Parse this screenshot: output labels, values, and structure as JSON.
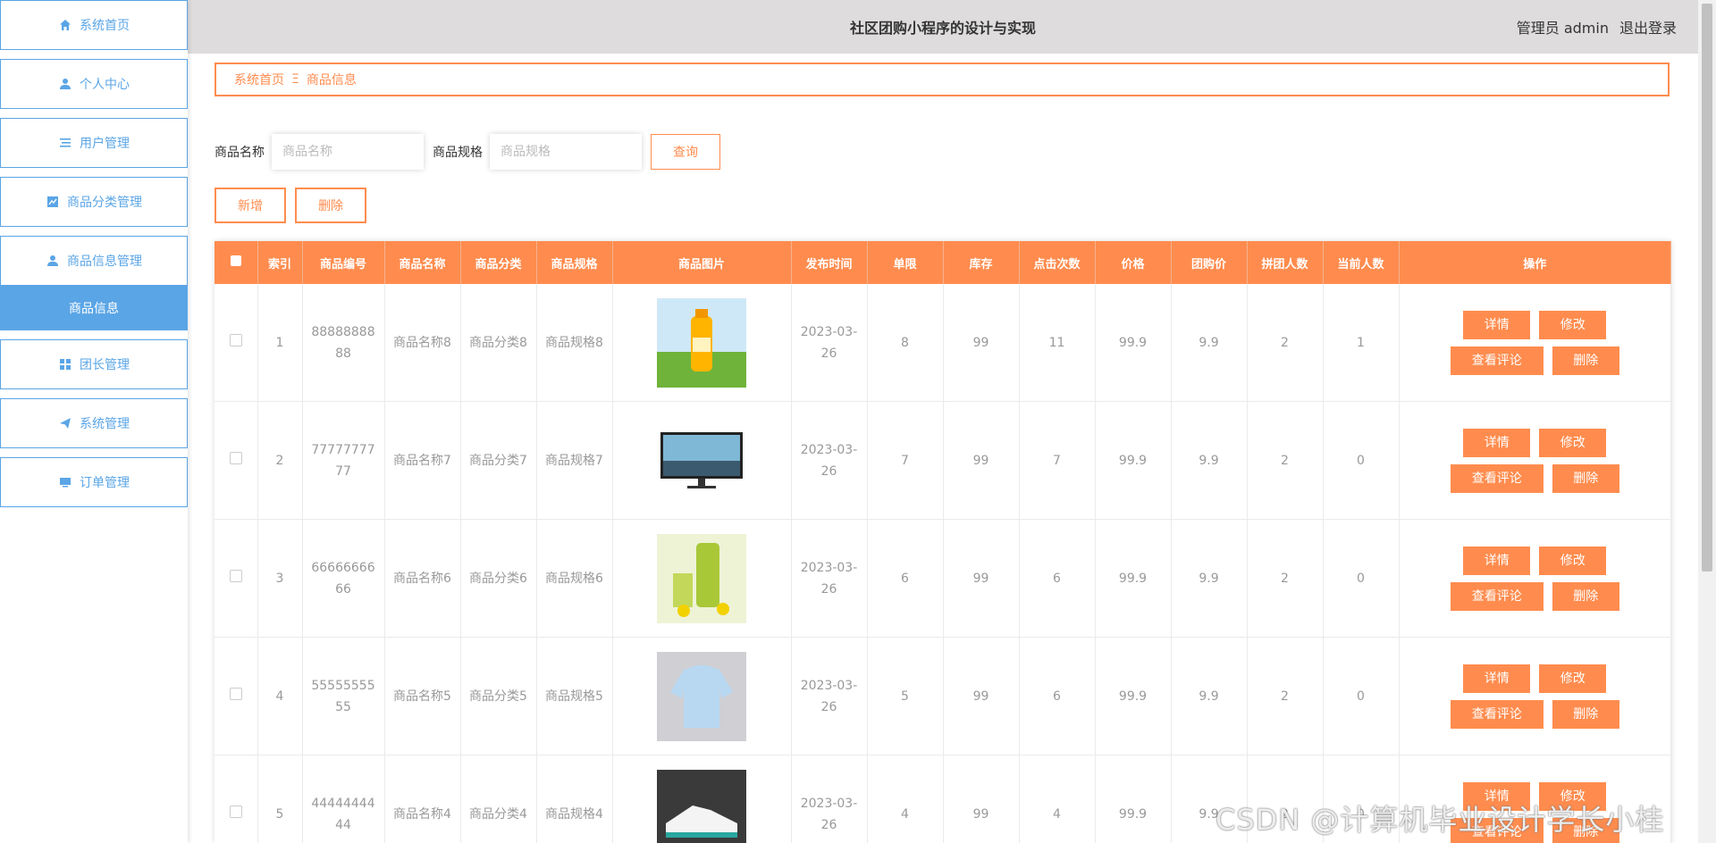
{
  "header": {
    "title": "社区团购小程序的设计与实现",
    "user": "管理员 admin",
    "logout": "退出登录"
  },
  "sidebar": {
    "items": [
      {
        "label": "系统首页",
        "icon": "home-icon"
      },
      {
        "label": "个人中心",
        "icon": "user-icon"
      },
      {
        "label": "用户管理",
        "icon": "list-icon"
      },
      {
        "label": "商品分类管理",
        "icon": "chart-icon"
      },
      {
        "label": "商品信息管理",
        "icon": "user-icon"
      },
      {
        "label": "团长管理",
        "icon": "grid-icon"
      },
      {
        "label": "系统管理",
        "icon": "send-icon"
      },
      {
        "label": "订单管理",
        "icon": "monitor-icon"
      }
    ],
    "sub": "商品信息"
  },
  "breadcrumb": {
    "home": "系统首页",
    "sep": "Ξ",
    "current": "商品信息"
  },
  "search": {
    "name_label": "商品名称",
    "name_placeholder": "商品名称",
    "spec_label": "商品规格",
    "spec_placeholder": "商品规格",
    "query": "查询"
  },
  "actions": {
    "add": "新增",
    "delete": "删除"
  },
  "table": {
    "headers": [
      "索引",
      "商品编号",
      "商品名称",
      "商品分类",
      "商品规格",
      "商品图片",
      "发布时间",
      "单限",
      "库存",
      "点击次数",
      "价格",
      "团购价",
      "拼团人数",
      "当前人数",
      "操作"
    ],
    "ops": {
      "detail": "详情",
      "edit": "修改",
      "comments": "查看评论",
      "delete": "删除"
    },
    "rows": [
      {
        "idx": "1",
        "code": "8888888888",
        "name": "商品名称8",
        "cat": "商品分类8",
        "spec": "商品规格8",
        "image": "orange-juice",
        "date": "2023-03-26",
        "limit": "8",
        "stock": "99",
        "clicks": "11",
        "price": "99.9",
        "group": "9.9",
        "pin": "2",
        "cur": "1"
      },
      {
        "idx": "2",
        "code": "7777777777",
        "name": "商品名称7",
        "cat": "商品分类7",
        "spec": "商品规格7",
        "image": "monitor",
        "date": "2023-03-26",
        "limit": "7",
        "stock": "99",
        "clicks": "7",
        "price": "99.9",
        "group": "9.9",
        "pin": "2",
        "cur": "0"
      },
      {
        "idx": "3",
        "code": "6666666666",
        "name": "商品名称6",
        "cat": "商品分类6",
        "spec": "商品规格6",
        "image": "green-juice",
        "date": "2023-03-26",
        "limit": "6",
        "stock": "99",
        "clicks": "6",
        "price": "99.9",
        "group": "9.9",
        "pin": "2",
        "cur": "0"
      },
      {
        "idx": "4",
        "code": "5555555555",
        "name": "商品名称5",
        "cat": "商品分类5",
        "spec": "商品规格5",
        "image": "blouse",
        "date": "2023-03-26",
        "limit": "5",
        "stock": "99",
        "clicks": "6",
        "price": "99.9",
        "group": "9.9",
        "pin": "2",
        "cur": "0"
      },
      {
        "idx": "5",
        "code": "4444444444",
        "name": "商品名称4",
        "cat": "商品分类4",
        "spec": "商品规格4",
        "image": "sneaker",
        "date": "2023-03-26",
        "limit": "4",
        "stock": "99",
        "clicks": "4",
        "price": "99.9",
        "group": "9.9",
        "pin": "2",
        "cur": "0"
      }
    ]
  },
  "watermark": "CSDN @计算机毕业设计学长小桂",
  "colors": {
    "accent": "#ff8c4e",
    "nav": "#5aa5e6",
    "header_bg": "#dedcdd"
  }
}
